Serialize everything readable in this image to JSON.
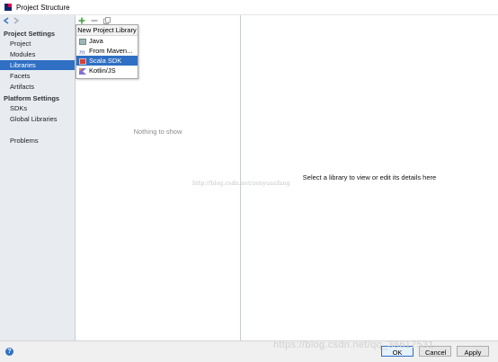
{
  "window": {
    "title": "Project Structure"
  },
  "sidebar": {
    "sections": [
      {
        "header": "Project Settings",
        "items": [
          "Project",
          "Modules",
          "Libraries",
          "Facets",
          "Artifacts"
        ]
      },
      {
        "header": "Platform Settings",
        "items": [
          "SDKs",
          "Global Libraries"
        ]
      }
    ],
    "extra_items": [
      "Problems"
    ],
    "selected": "Libraries"
  },
  "libraries": {
    "empty_text": "Nothing to show",
    "details_placeholder": "Select a library to view or edit its details here"
  },
  "popup": {
    "title": "New Project Library",
    "items": [
      {
        "label": "Java",
        "icon": "jar-icon"
      },
      {
        "label": "From Maven...",
        "icon": "maven-icon"
      },
      {
        "label": "Scala SDK",
        "icon": "scala-icon",
        "selected": true
      },
      {
        "label": "Kotlin/JS",
        "icon": "kotlin-icon"
      }
    ]
  },
  "footer": {
    "ok_label": "OK",
    "cancel_label": "Cancel",
    "apply_label": "Apply"
  },
  "watermarks": {
    "center": "http://blog.csdn.net/zenyuanfang",
    "corner": "https://blog.csdn.net/qq_38617531"
  },
  "colors": {
    "selection": "#2f6fc4",
    "sidebar_bg": "#e8ecf1",
    "add_icon": "#3f9f3f"
  }
}
